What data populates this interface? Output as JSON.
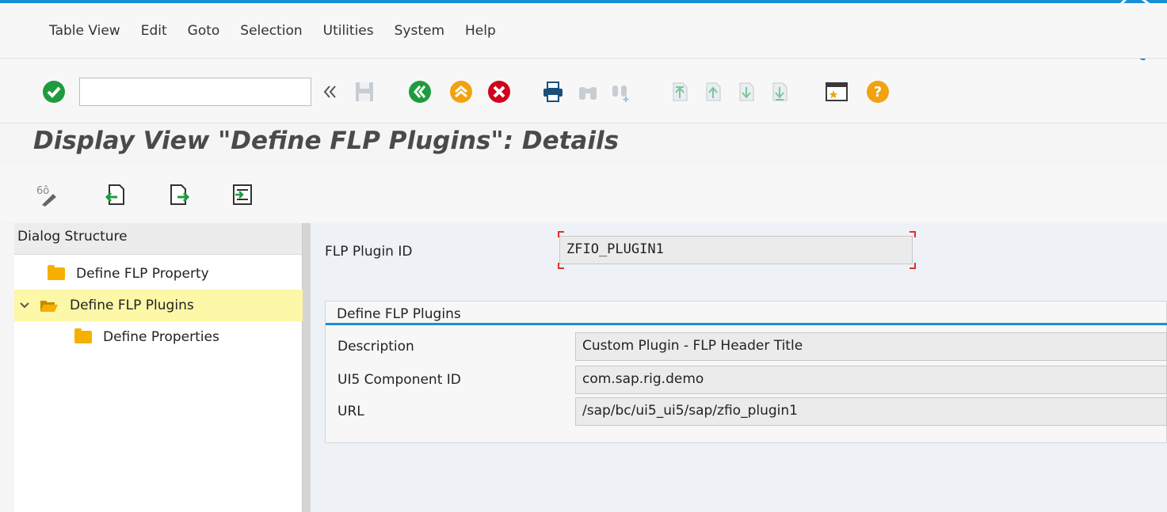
{
  "menu": [
    "Table View",
    "Edit",
    "Goto",
    "Selection",
    "Utilities",
    "System",
    "Help"
  ],
  "toolbar": {
    "command_value": "",
    "icons": [
      "enter-icon",
      "collapse-icon",
      "save-icon",
      "back-icon",
      "exit-icon",
      "cancel-icon",
      "print-icon",
      "find-icon",
      "find-next-icon",
      "first-page-icon",
      "previous-page-icon",
      "next-page-icon",
      "last-page-icon",
      "shortcut-icon",
      "help-icon"
    ]
  },
  "title": "Display View \"Define FLP Plugins\": Details",
  "subtoolbar": {
    "icons": [
      "display-change-icon",
      "previous-entry-icon",
      "next-entry-icon",
      "select-block-icon"
    ]
  },
  "dialog_structure": {
    "header": "Dialog Structure",
    "items": [
      {
        "label": "Define FLP Property",
        "selected": false,
        "expanded": false
      },
      {
        "label": "Define FLP Plugins",
        "selected": true,
        "expanded": true
      },
      {
        "label": "Define Properties",
        "selected": false,
        "expanded": false
      }
    ]
  },
  "detail": {
    "plugin_id_label": "FLP Plugin ID",
    "plugin_id_value": "ZFIO_PLUGIN1",
    "group_title": "Define FLP Plugins",
    "fields": [
      {
        "label": "Description",
        "value": "Custom Plugin - FLP Header Title"
      },
      {
        "label": "UI5 Component ID",
        "value": "com.sap.rig.demo"
      },
      {
        "label": "URL",
        "value": "/sap/bc/ui5_ui5/sap/zfio_plugin1"
      }
    ]
  },
  "colors": {
    "accent_blue": "#1a8fd6",
    "green": "#1e9b3f",
    "orange": "#f2a20f",
    "red": "#d0021b",
    "selected_row": "#fdf7a8",
    "folder": "#f5b000",
    "required_marker": "#e0302a"
  }
}
